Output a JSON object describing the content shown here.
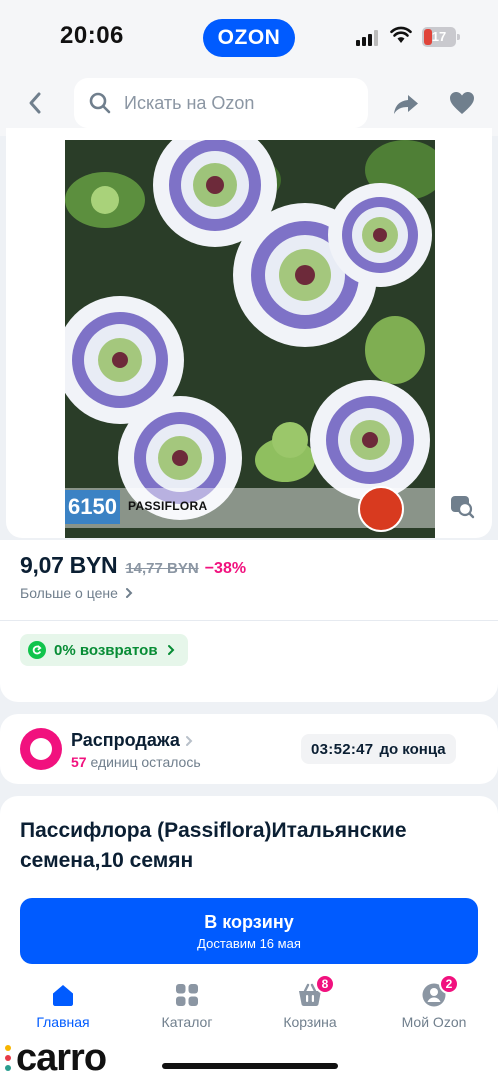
{
  "status_bar": {
    "time": "20:06",
    "battery": "17",
    "app_badge": "OZON"
  },
  "header": {
    "search_placeholder": "Искать на Ozon",
    "icons": [
      "back-icon",
      "search-icon",
      "share-icon",
      "heart-icon"
    ]
  },
  "product_image": {
    "code": "6150",
    "name": "PASSIFLORA",
    "icons": [
      "visual-search-icon"
    ]
  },
  "price": {
    "current": "9,07 BYN",
    "old": "14,77 BYN",
    "discount": "−38%",
    "more_label": "Больше о цене"
  },
  "returns": {
    "label": "0% возвратов"
  },
  "sale": {
    "title": "Распродажа",
    "remaining_count": "57",
    "remaining_text": "единиц осталось",
    "timer_value": "03:52:47",
    "timer_label": "до конца"
  },
  "product": {
    "title": "Пассифлора (Passiflora)Итальянские семена,10 семян"
  },
  "cart_button": {
    "label": "В корзину",
    "delivery": "Доставим 16 мая"
  },
  "tabs": [
    {
      "label": "Главная",
      "icon": "home-icon",
      "active": true
    },
    {
      "label": "Каталог",
      "icon": "catalog-icon",
      "active": false
    },
    {
      "label": "Корзина",
      "icon": "cart-icon",
      "badge": "8",
      "active": false
    },
    {
      "label": "Мой Ozon",
      "icon": "profile-icon",
      "badge": "2",
      "active": false
    }
  ],
  "watermark": {
    "text": "carro"
  },
  "colors": {
    "brand_blue": "#005bff",
    "discount_pink": "#f1117e",
    "returns_green": "#10c44c",
    "text_dark": "#0b1f33",
    "text_muted": "#707f8d"
  }
}
